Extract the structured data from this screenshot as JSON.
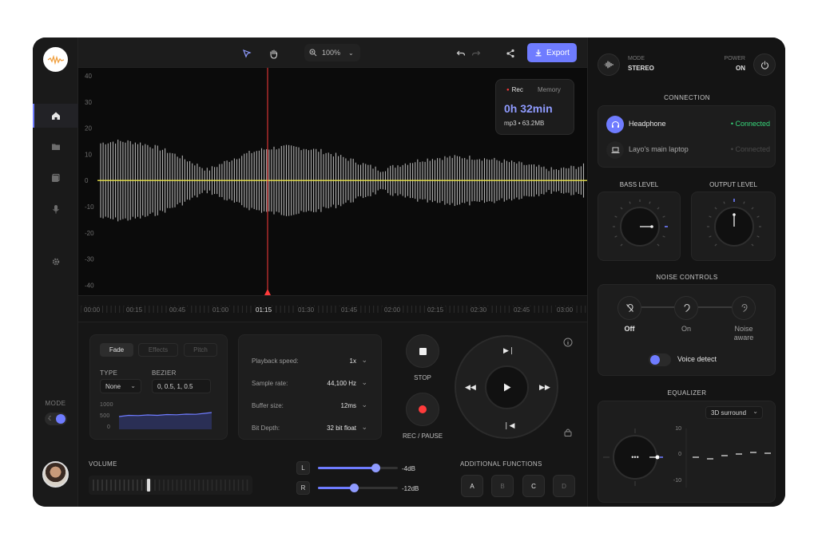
{
  "sidebar": {
    "mode_label": "MODE"
  },
  "toolbar": {
    "zoom_value": "100%",
    "export_label": "Export"
  },
  "waveform": {
    "y_ticks": [
      "40",
      "30",
      "20",
      "10",
      "0",
      "-10",
      "-20",
      "-30",
      "-40"
    ],
    "recording": {
      "tab_active": "Rec",
      "tab_inactive": "Memory",
      "duration": "0h 32min",
      "info": "mp3 • 63.2MB"
    },
    "timeline": {
      "labels": [
        "00:00",
        "00:15",
        "00:45",
        "01:00",
        "01:15",
        "01:30",
        "01:45",
        "02:00",
        "02:15",
        "02:30",
        "02:45",
        "03:00"
      ],
      "active_label": "01:15"
    }
  },
  "fade_panel": {
    "tabs": [
      "Fade",
      "Effects",
      "Pitch"
    ],
    "type_label": "TYPE",
    "bezier_label": "BEZIER",
    "type_value": "None",
    "bezier_value": "0, 0.5, 1, 0.5",
    "chart_ticks": [
      "1000",
      "500",
      "0"
    ]
  },
  "settings": {
    "rows": [
      {
        "label": "Playback speed:",
        "value": "1x"
      },
      {
        "label": "Sample rate:",
        "value": "44,100 Hz"
      },
      {
        "label": "Buffer size:",
        "value": "12ms"
      },
      {
        "label": "Bit Depth:",
        "value": "32 bit float"
      }
    ]
  },
  "transport": {
    "stop_label": "STOP",
    "rec_label": "REC / PAUSE"
  },
  "volume": {
    "label": "VOLUME",
    "left": {
      "channel": "L",
      "value": "-4dB",
      "level": 0.72
    },
    "right": {
      "channel": "R",
      "value": "-12dB",
      "level": 0.45
    }
  },
  "additional": {
    "label": "ADDITIONAL FUNCTIONS",
    "buttons": [
      "A",
      "B",
      "C",
      "D"
    ]
  },
  "right_panel": {
    "mode_label": "MODE",
    "mode_value": "STEREO",
    "power_label": "POWER",
    "power_value": "ON",
    "connection_title": "CONNECTION",
    "devices": [
      {
        "name": "Headphone",
        "status": "• Connected"
      },
      {
        "name": "Layo's main laptop",
        "status": "• Connected"
      }
    ],
    "bass_title": "BASS LEVEL",
    "output_title": "OUTPUT LEVEL",
    "noise_title": "NOISE CONTROLS",
    "noise_options": [
      "Off",
      "On",
      "Noise\naware"
    ],
    "voice_detect_label": "Voice detect",
    "equalizer_title": "EQUALIZER",
    "eq_preset": "3D surround",
    "eq_ticks": [
      "10",
      "0",
      "-10"
    ]
  },
  "colors": {
    "accent": "#6f7cff",
    "connected": "#37d67a",
    "record": "#ff3b3b",
    "wave_line": "#e8e24a"
  }
}
